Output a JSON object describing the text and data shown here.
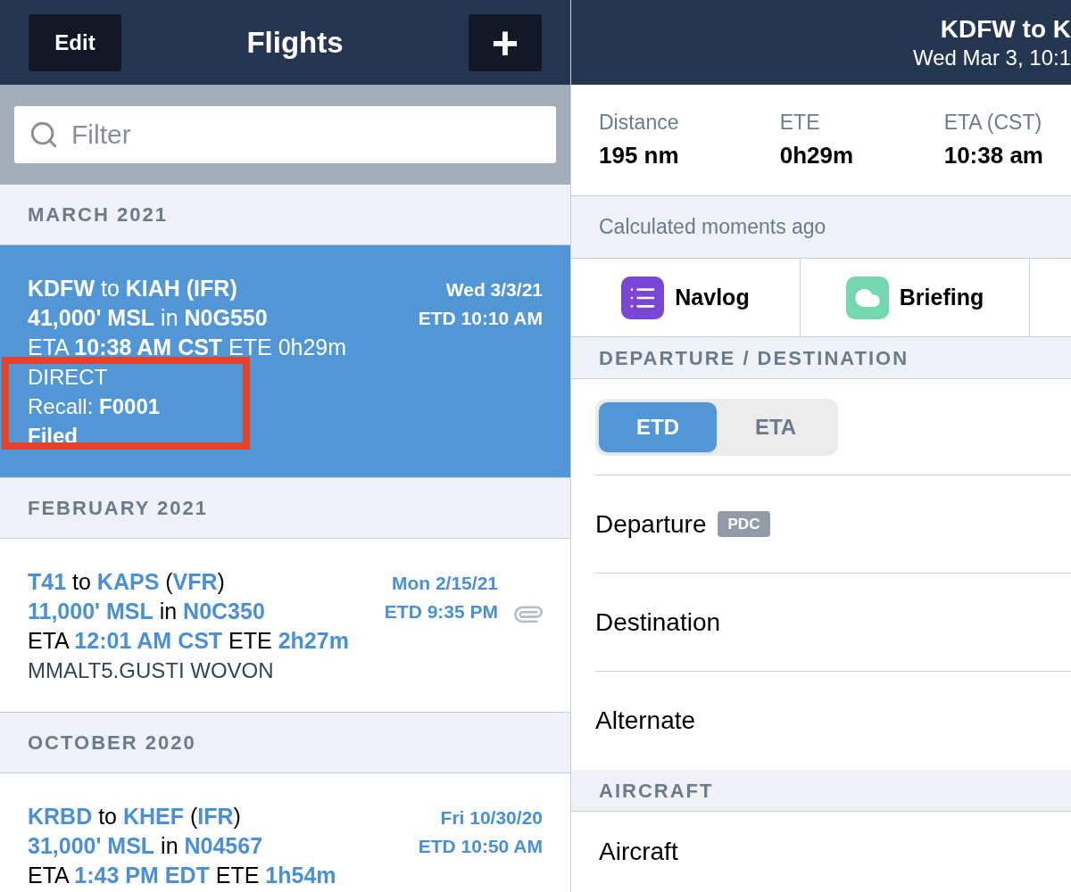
{
  "list_header": {
    "edit_button": "Edit",
    "title": "Flights",
    "add_button": "+"
  },
  "filter": {
    "placeholder": "Filter"
  },
  "sections": [
    {
      "heading": "MARCH 2021",
      "flights": [
        {
          "selected": true,
          "attachment": false,
          "date": "Wed 3/3/21",
          "etd": "ETD 10:10 AM",
          "lines": [
            [
              {
                "text": "KDFW",
                "hl": true
              },
              {
                "text": " to ",
                "hl": false
              },
              {
                "text": "KIAH (IFR)",
                "hl": true
              }
            ],
            [
              {
                "text": "41,000' MSL",
                "hl": true
              },
              {
                "text": " in ",
                "hl": false
              },
              {
                "text": "N0G550",
                "hl": true
              }
            ],
            [
              {
                "text": "ETA ",
                "hl": false
              },
              {
                "text": "10:38 AM CST",
                "hl": true
              },
              {
                "text": " ETE 0h29m",
                "hl": false
              }
            ]
          ],
          "details_framed": true,
          "details": [
            [
              {
                "text": "DIRECT",
                "hl": false
              }
            ],
            [
              {
                "text": "Recall: ",
                "hl": false
              },
              {
                "text": "F0001",
                "hl": true
              }
            ],
            [
              {
                "text": "Filed",
                "hl": true
              }
            ]
          ]
        }
      ]
    },
    {
      "heading": "FEBRUARY 2021",
      "flights": [
        {
          "selected": false,
          "attachment": true,
          "date": "Mon 2/15/21",
          "etd": "ETD 9:35 PM",
          "lines": [
            [
              {
                "text": "T41",
                "hl": true
              },
              {
                "text": " to ",
                "hl": false
              },
              {
                "text": "KAPS",
                "hl": true
              },
              {
                "text": " (",
                "hl": false
              },
              {
                "text": "VFR",
                "hl": true
              },
              {
                "text": ")",
                "hl": false
              }
            ],
            [
              {
                "text": "11,000' MSL",
                "hl": true
              },
              {
                "text": " in ",
                "hl": false
              },
              {
                "text": "N0C350",
                "hl": true
              }
            ],
            [
              {
                "text": "ETA ",
                "hl": false
              },
              {
                "text": "12:01 AM CST",
                "hl": true
              },
              {
                "text": " ETE ",
                "hl": false
              },
              {
                "text": "2h27m",
                "hl": true
              }
            ]
          ],
          "details_framed": false,
          "details": [
            [
              {
                "text": "MMALT5.GUSTI WOVON",
                "hl": false
              }
            ]
          ]
        }
      ]
    },
    {
      "heading": "OCTOBER 2020",
      "flights": [
        {
          "selected": false,
          "attachment": false,
          "date": "Fri 10/30/20",
          "etd": "ETD 10:50 AM",
          "lines": [
            [
              {
                "text": "KRBD",
                "hl": true
              },
              {
                "text": " to ",
                "hl": false
              },
              {
                "text": "KHEF",
                "hl": true
              },
              {
                "text": " (",
                "hl": false
              },
              {
                "text": "IFR",
                "hl": true
              },
              {
                "text": ")",
                "hl": false
              }
            ],
            [
              {
                "text": "31,000' MSL",
                "hl": true
              },
              {
                "text": " in ",
                "hl": false
              },
              {
                "text": "N04567",
                "hl": true
              }
            ],
            [
              {
                "text": "ETA ",
                "hl": false
              },
              {
                "text": "1:43 PM EDT",
                "hl": true
              },
              {
                "text": " ETE ",
                "hl": false
              },
              {
                "text": "1h54m",
                "hl": true
              }
            ]
          ],
          "details_framed": false
        }
      ]
    }
  ],
  "detail_header": {
    "title": "KDFW to K",
    "subtitle": "Wed Mar 3, 10:1"
  },
  "stats": [
    {
      "label": "Distance",
      "value": "195 nm"
    },
    {
      "label": "ETE",
      "value": "0h29m"
    },
    {
      "label": "ETA (CST)",
      "value": "10:38 am"
    }
  ],
  "calculated_note": "Calculated moments ago",
  "actions": [
    {
      "kind": "navlog",
      "label": "Navlog"
    },
    {
      "kind": "briefing",
      "label": "Briefing"
    },
    {
      "kind": "empty"
    }
  ],
  "departure_section": {
    "heading": "DEPARTURE / DESTINATION",
    "time_toggle": [
      {
        "label": "ETD",
        "selected": true
      },
      {
        "label": "ETA",
        "selected": false
      }
    ],
    "rows": [
      {
        "label": "Departure",
        "badge": "PDC"
      },
      {
        "label": "Destination"
      },
      {
        "label": "Alternate"
      }
    ]
  },
  "aircraft_section": {
    "heading": "AIRCRAFT",
    "rows": [
      {
        "label": "Aircraft"
      }
    ]
  }
}
